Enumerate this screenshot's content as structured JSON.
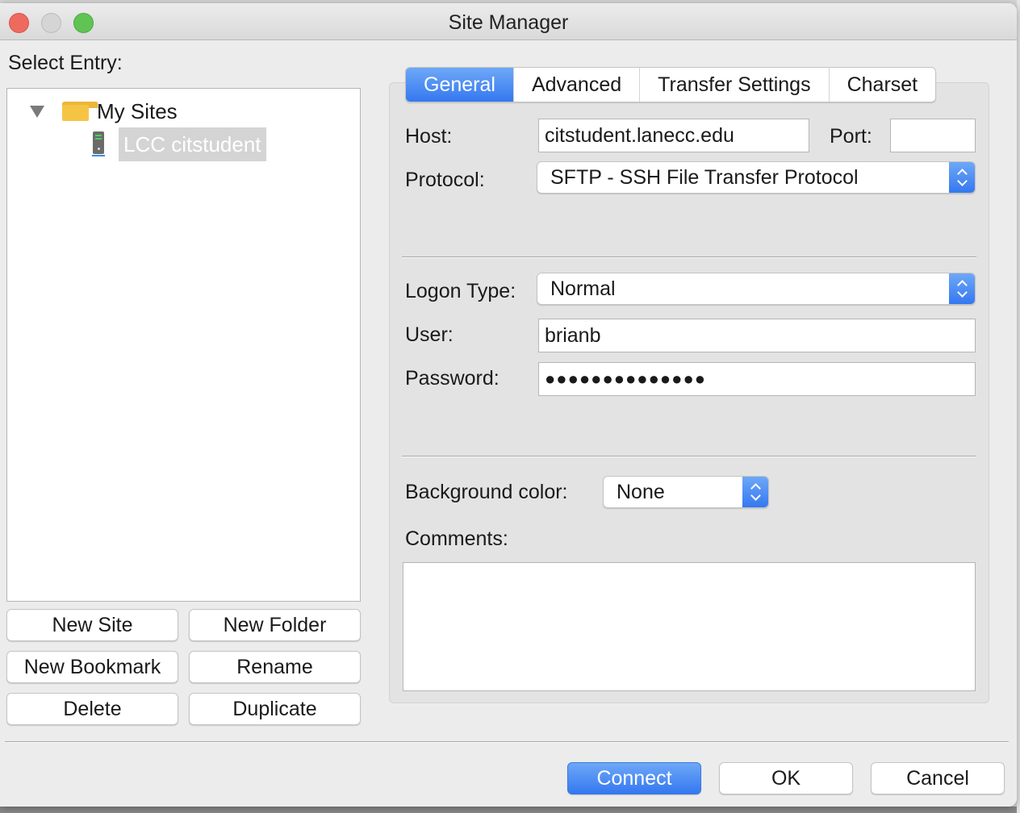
{
  "window": {
    "title": "Site Manager"
  },
  "left_pane": {
    "select_label": "Select Entry:",
    "tree": {
      "root": {
        "label": "My Sites",
        "icon": "folder-icon",
        "expanded": true
      },
      "children": [
        {
          "label": "LCC citstudent",
          "icon": "server-icon",
          "selected": true
        }
      ]
    },
    "buttons": {
      "new_site": "New Site",
      "new_folder": "New Folder",
      "new_bookmark": "New Bookmark",
      "rename": "Rename",
      "delete": "Delete",
      "duplicate": "Duplicate"
    }
  },
  "tabs": [
    {
      "label": "General",
      "active": true
    },
    {
      "label": "Advanced",
      "active": false
    },
    {
      "label": "Transfer Settings",
      "active": false
    },
    {
      "label": "Charset",
      "active": false
    }
  ],
  "general": {
    "host_label": "Host:",
    "host_value": "citstudent.lanecc.edu",
    "port_label": "Port:",
    "port_value": "",
    "protocol_label": "Protocol:",
    "protocol_value": "SFTP - SSH File Transfer Protocol",
    "logon_type_label": "Logon Type:",
    "logon_type_value": "Normal",
    "user_label": "User:",
    "user_value": "brianb",
    "password_label": "Password:",
    "password_masked": "●●●●●●●●●●●●●●",
    "background_color_label": "Background color:",
    "background_color_value": "None",
    "comments_label": "Comments:",
    "comments_value": ""
  },
  "footer": {
    "connect": "Connect",
    "ok": "OK",
    "cancel": "Cancel"
  },
  "colors": {
    "accent": "#3478f0",
    "selection_bg": "#d4d4d4",
    "window_bg": "#ececec",
    "panel_bg": "#e3e3e3"
  }
}
